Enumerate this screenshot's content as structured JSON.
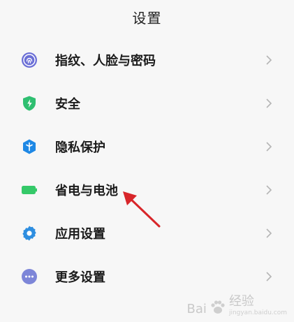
{
  "header": {
    "title": "设置"
  },
  "items": [
    {
      "label": "指纹、人脸与密码",
      "icon": "fingerprint-icon",
      "color": "#6b6fd6"
    },
    {
      "label": "安全",
      "icon": "shield-icon",
      "color": "#2fbf71"
    },
    {
      "label": "隐私保护",
      "icon": "privacy-icon",
      "color": "#1e88e5"
    },
    {
      "label": "省电与电池",
      "icon": "battery-icon",
      "color": "#35c969"
    },
    {
      "label": "应用设置",
      "icon": "gear-icon",
      "color": "#2e8ee0"
    },
    {
      "label": "更多设置",
      "icon": "more-icon",
      "color": "#7d86d8"
    }
  ],
  "watermark": {
    "text_left": "Bai",
    "text_right": "经验",
    "sub": "jingyan.baidu.com"
  },
  "annotation": {
    "arrow_color": "#d8262a"
  }
}
